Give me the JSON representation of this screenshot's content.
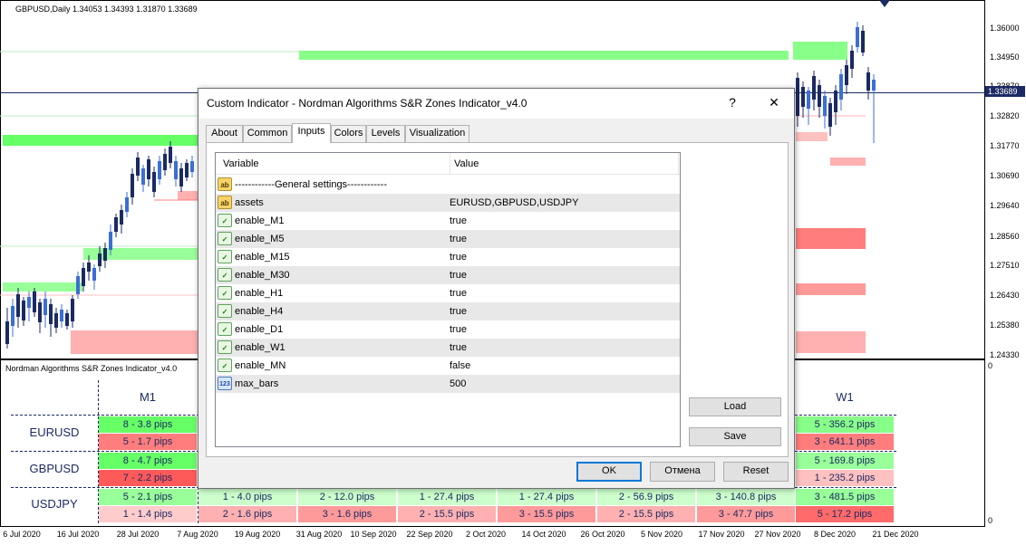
{
  "chart": {
    "symbol_header": "GBPUSD,Daily  1.34053 1.34393 1.31870 1.33689",
    "price_axis": [
      "1.36000",
      "1.34950",
      "1.33870",
      "1.32820",
      "1.31770",
      "1.30690",
      "1.29640",
      "1.28560",
      "1.27510",
      "1.26430",
      "1.25380",
      "1.24330"
    ],
    "current_price": "1.33689",
    "date_axis": [
      "6 Jul 2020",
      "16 Jul 2020",
      "28 Jul 2020",
      "7 Aug 2020",
      "19 Aug 2020",
      "31 Aug 2020",
      "10 Sep 2020",
      "22 Sep 2020",
      "2 Oct 2020",
      "14 Oct 2020",
      "26 Oct 2020",
      "5 Nov 2020",
      "17 Nov 2020",
      "27 Nov 2020",
      "8 Dec 2020",
      "21 Dec 2020"
    ],
    "colors": {
      "bull": "#1b2a63",
      "bear": "#3b6fd6",
      "support": "#7dff7d",
      "resistance": "#ff8a8a"
    }
  },
  "indicator_panel": {
    "title": "Nordman Algorithms S&R Zones Indicator_v4.0",
    "scale_top": "0",
    "scale_bottom": "0",
    "timeframes": [
      "M1",
      "W1"
    ],
    "rows": [
      {
        "symbol": "EURUSD",
        "first": [
          "8 - 3.8 pips",
          "5 - 1.7 pips"
        ],
        "last": [
          "5 - 356.2 pips",
          "3 - 641.1 pips"
        ]
      },
      {
        "symbol": "GBPUSD",
        "first": [
          "8 - 4.7 pips",
          "7 - 2.2 pips"
        ],
        "last": [
          "5 - 169.8 pips",
          "1 - 235.2 pips"
        ]
      },
      {
        "symbol": "USDJPY",
        "cells_top": [
          "5 - 2.1 pips",
          "1 - 4.0 pips",
          "2 - 12.0 pips",
          "1 - 27.4 pips",
          "1 - 27.4 pips",
          "2 - 56.9 pips",
          "3 - 140.8 pips",
          "3 - 481.5 pips"
        ],
        "cells_bottom": [
          "1 - 1.4 pips",
          "2 - 1.6 pips",
          "3 - 1.6 pips",
          "2 - 15.5 pips",
          "3 - 15.5 pips",
          "2 - 15.5 pips",
          "3 - 47.7 pips",
          "5 - 17.2 pips"
        ]
      }
    ]
  },
  "dialog": {
    "title": "Custom Indicator - Nordman Algorithms S&R Zones Indicator_v4.0",
    "help_label": "?",
    "close_label": "✕",
    "tabs": [
      "About",
      "Common",
      "Inputs",
      "Colors",
      "Levels",
      "Visualization"
    ],
    "active_tab": "Inputs",
    "columns": {
      "variable": "Variable",
      "value": "Value"
    },
    "params": [
      {
        "icon": "ab",
        "name": "------------General settings------------",
        "value": ""
      },
      {
        "icon": "ab",
        "name": "assets",
        "value": "EURUSD,GBPUSD,USDJPY"
      },
      {
        "icon": "bool",
        "name": "enable_M1",
        "value": "true"
      },
      {
        "icon": "bool",
        "name": "enable_M5",
        "value": "true"
      },
      {
        "icon": "bool",
        "name": "enable_M15",
        "value": "true"
      },
      {
        "icon": "bool",
        "name": "enable_M30",
        "value": "true"
      },
      {
        "icon": "bool",
        "name": "enable_H1",
        "value": "true"
      },
      {
        "icon": "bool",
        "name": "enable_H4",
        "value": "true"
      },
      {
        "icon": "bool",
        "name": "enable_D1",
        "value": "true"
      },
      {
        "icon": "bool",
        "name": "enable_W1",
        "value": "true"
      },
      {
        "icon": "bool",
        "name": "enable_MN",
        "value": "false"
      },
      {
        "icon": "num",
        "name": "max_bars",
        "value": "500"
      }
    ],
    "buttons": {
      "load": "Load",
      "save": "Save",
      "ok": "OK",
      "cancel": "Отмена",
      "reset": "Reset"
    }
  }
}
